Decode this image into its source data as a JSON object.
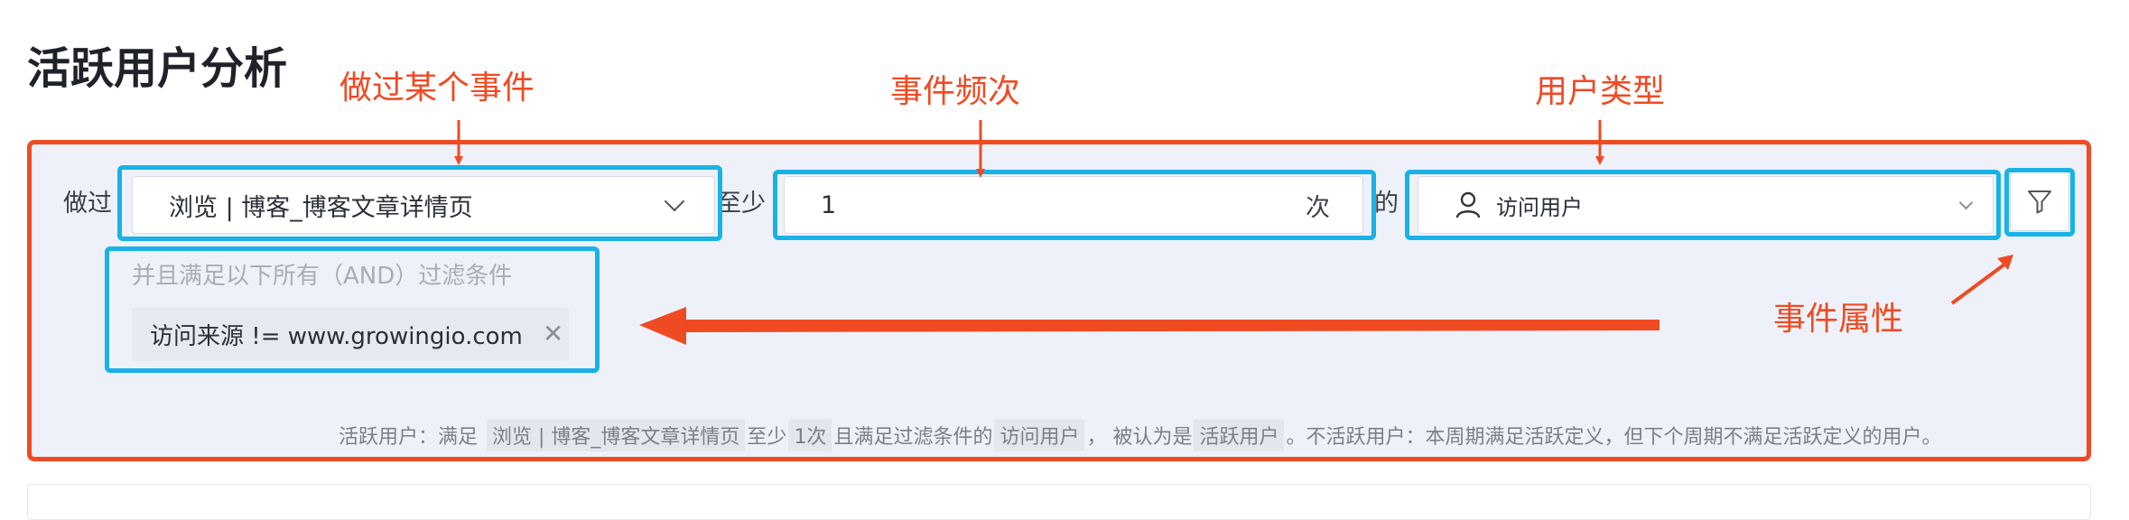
{
  "page": {
    "title": "活跃用户分析"
  },
  "condition": {
    "did_label": "做过",
    "event_value": "浏览 | 博客_博客文章详情页",
    "at_least_label": "至少",
    "frequency_value": "1",
    "frequency_unit": "次",
    "of_label": "的",
    "user_type_value": "访问用户"
  },
  "filters": {
    "hint": "并且满足以下所有（AND）过滤条件",
    "tags": [
      {
        "label": "访问来源 != www.growingio.com"
      }
    ]
  },
  "summary": {
    "p1": "活跃用户：满足",
    "event": "浏览 | 博客_博客文章详情页",
    "p2": "至少",
    "count": "1次",
    "p3": "且满足过滤条件的",
    "user_type": "访问用户",
    "p4": "，  被认为是",
    "active": "活跃用户",
    "p5": "。不活跃用户：本周期满足活跃定义，但下个周期不满足活跃定义的用户。"
  },
  "annotations": {
    "event": "做过某个事件",
    "frequency": "事件频次",
    "user_type": "用户类型",
    "event_property": "事件属性"
  },
  "colors": {
    "highlight": "#18b2e6",
    "annotation": "#f04a23",
    "panel": "#eef1f9"
  },
  "icons": {
    "dropdown": "chevron-down-icon",
    "user": "user-icon",
    "filter": "filter-icon",
    "close": "close-icon"
  }
}
